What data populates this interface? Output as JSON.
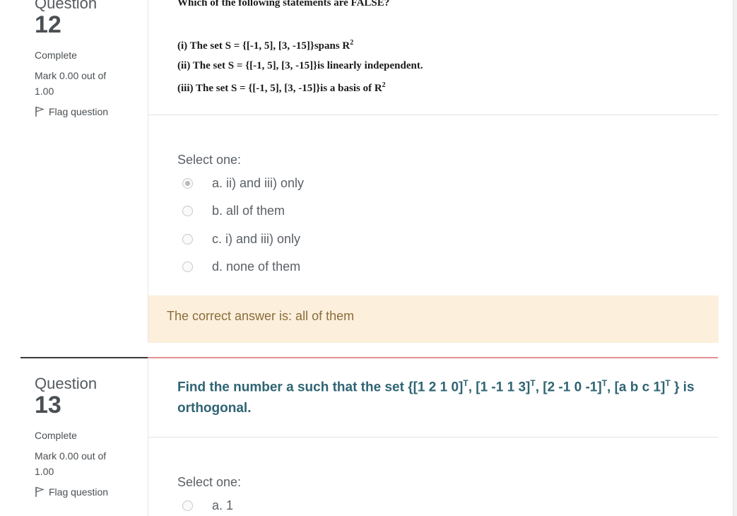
{
  "q12": {
    "label": "Question",
    "number": "12",
    "state": "Complete",
    "grade": "Mark 0.00 out of 1.00",
    "flag_label": "Flag question",
    "prompt": "Which of the following statements are FALSE?",
    "statements": [
      {
        "text": "(i) The set S = {[-1, 5], [3, -15]}spans R",
        "sup": "2"
      },
      {
        "text": "(ii) The set S = {[-1, 5], [3, -15]}is linearly independent.",
        "sup": ""
      },
      {
        "text": "(iii) The set S = {[-1, 5], [3, -15]}is a basis of R",
        "sup": "2"
      }
    ],
    "select_label": "Select one:",
    "options": [
      {
        "label": "a. ii) and iii) only",
        "checked": true
      },
      {
        "label": "b. all of them",
        "checked": false
      },
      {
        "label": "c. i) and iii) only",
        "checked": false
      },
      {
        "label": "d. none of them",
        "checked": false
      }
    ],
    "feedback": "The correct answer is: all of them"
  },
  "q13": {
    "label": "Question",
    "number": "13",
    "state": "Complete",
    "grade": "Mark 0.00 out of 1.00",
    "flag_label": "Flag question",
    "prompt_parts": [
      {
        "text": "Find the number a such that the set {[1 2 1 0]",
        "sup": "T"
      },
      {
        "text": ", [1 -1 1 3]",
        "sup": "T"
      },
      {
        "text": ", [2 -1 0 -1]",
        "sup": "T"
      },
      {
        "text": ", [a b c 1]",
        "sup": "T"
      },
      {
        "text": " } is orthogonal.",
        "sup": ""
      }
    ],
    "select_label": "Select one:",
    "options": [
      {
        "label": "a. 1",
        "checked": false
      }
    ]
  },
  "colors": {
    "feedback_bg": "#fcefdc",
    "feedback_text": "#8a6d3b",
    "question_text": "#2f6473",
    "separator_accent": "#e58f92"
  }
}
